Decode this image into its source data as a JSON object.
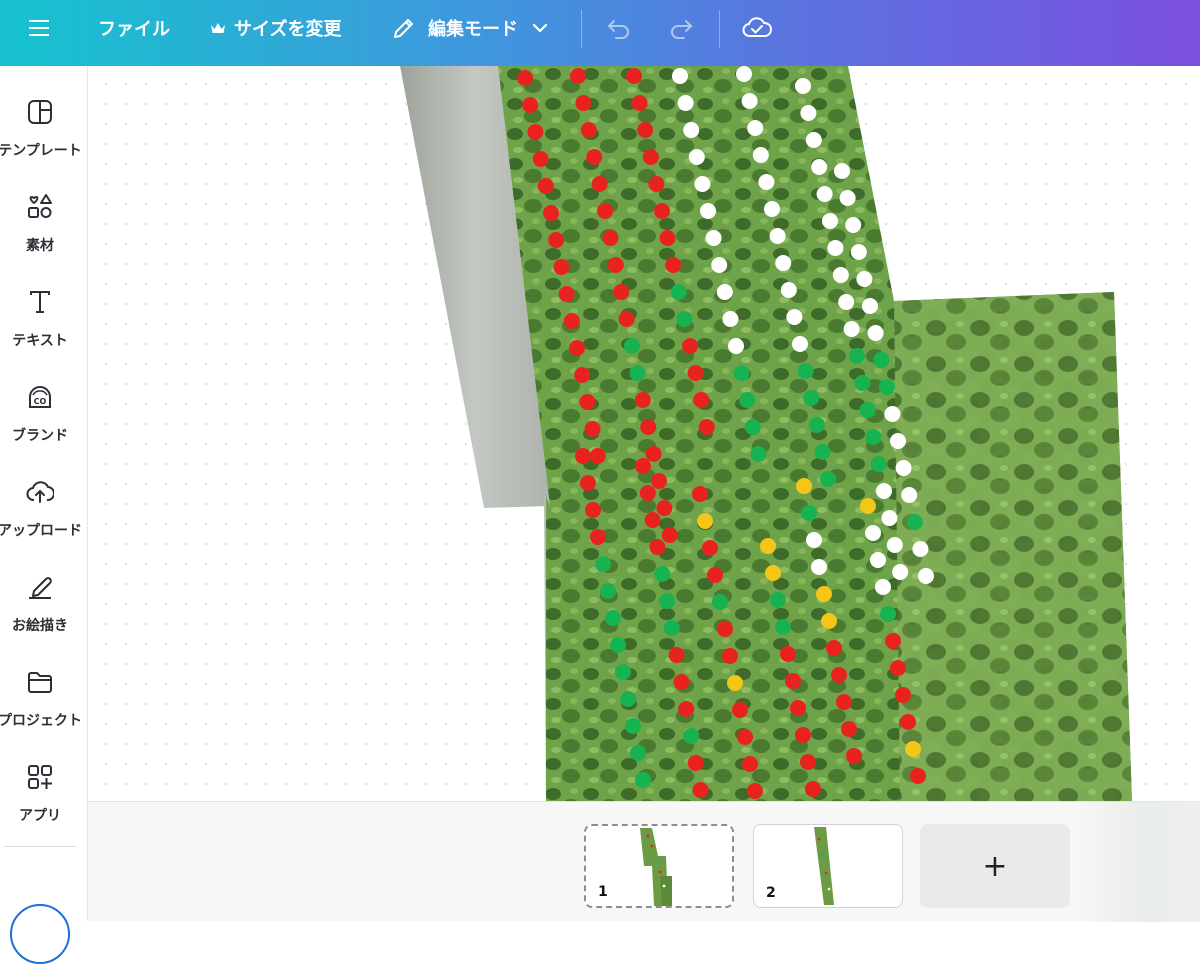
{
  "topbar": {
    "menu_icon": "hamburger-icon",
    "file_label": "ファイル",
    "resize_label": "サイズを変更",
    "resize_icon": "crown-icon",
    "edit_mode_label": "編集モード",
    "edit_icon": "pencil-icon",
    "undo_icon": "undo-icon",
    "redo_icon": "redo-icon",
    "save_status_icon": "cloud-check-icon"
  },
  "sidebar": {
    "items": [
      {
        "label": "テンプレート",
        "icon": "template-icon"
      },
      {
        "label": "素材",
        "icon": "elements-icon"
      },
      {
        "label": "テキスト",
        "icon": "text-icon"
      },
      {
        "label": "ブランド",
        "icon": "brand-icon"
      },
      {
        "label": "アップロード",
        "icon": "upload-icon"
      },
      {
        "label": "お絵描き",
        "icon": "draw-icon"
      },
      {
        "label": "プロジェクト",
        "icon": "folder-icon"
      },
      {
        "label": "アプリ",
        "icon": "apps-icon"
      }
    ]
  },
  "pages": {
    "items": [
      {
        "number": "1",
        "selected": true
      },
      {
        "number": "2",
        "selected": false
      }
    ],
    "add_label": "+"
  },
  "colors": {
    "accent_start": "#16c3ce",
    "accent_end": "#7b4fe0",
    "marker_red": "#e8231f",
    "marker_green": "#17b350",
    "marker_white": "#ffffff",
    "marker_yellow": "#f5c518"
  }
}
